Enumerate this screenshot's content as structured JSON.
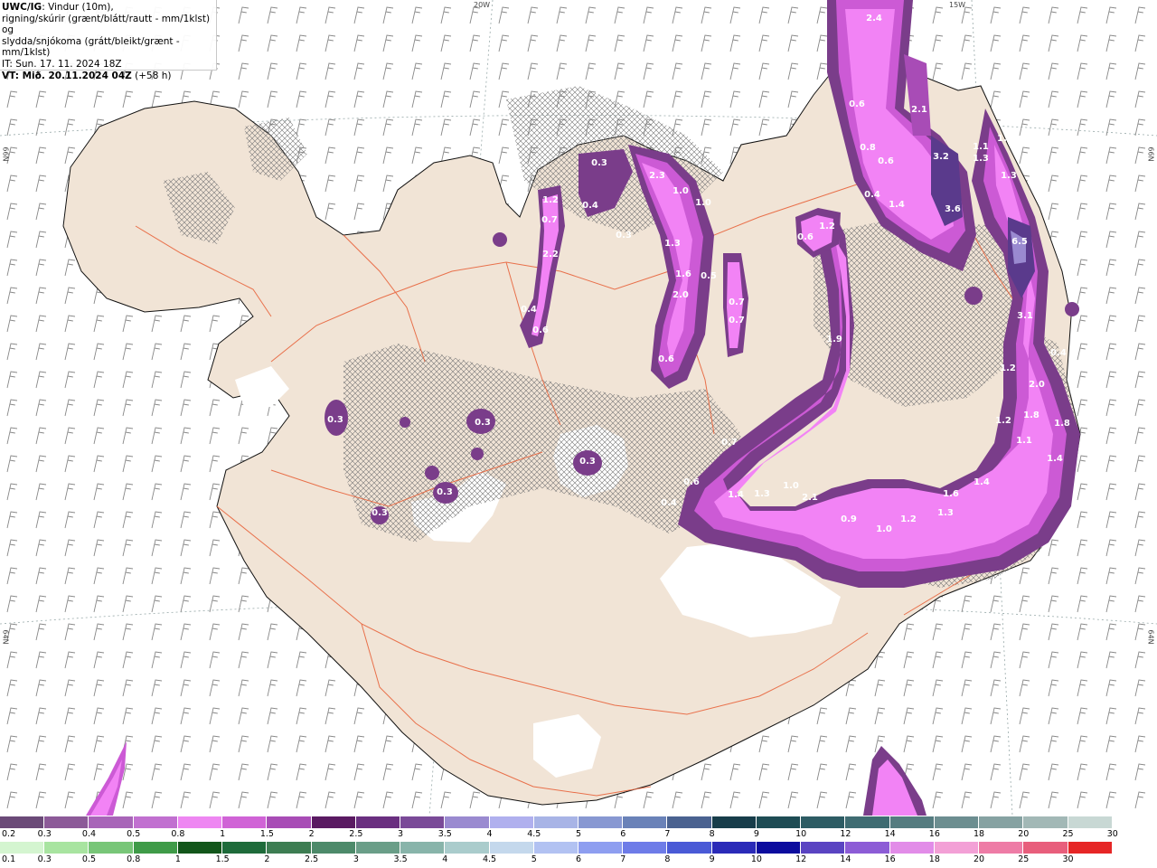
{
  "header": {
    "model": "UWC/IG",
    "title_rest": ": Vindur (10m),",
    "line2": "rigning/skúrir (grænt/blátt/rautt - mm/1klst) og",
    "line3": "slydda/snjókoma (grátt/bleikt/grænt - mm/1klst)",
    "issue_time": "IT: Sun. 17. 11. 2024 18Z",
    "valid_time": "VT: Mið. 20.11.2024 04Z",
    "forecast_offset": " (+58 h)"
  },
  "grid_labels": {
    "lon_20w": "20W",
    "lon_15w": "15W",
    "lat_66n_left": "66N",
    "lat_66n_right": "66N",
    "lat_64n_left": "64N",
    "lat_64n_right": "64N"
  },
  "colors": {
    "land": "#f1e4d6",
    "sea": "#ffffff",
    "roads": "#e8643c",
    "snow_light": "#f283f5",
    "snow_mid": "#cc5ad5",
    "snow_dark": "#7a3d8a",
    "snow_core": "#5a3a8c"
  },
  "precip_values": [
    {
      "v": "2.4"
    },
    {
      "v": "0.6"
    },
    {
      "v": "2.1"
    },
    {
      "v": "0.8"
    },
    {
      "v": "0.6"
    },
    {
      "v": "3.2"
    },
    {
      "v": "1.1"
    },
    {
      "v": "1.3"
    },
    {
      "v": "0.4"
    },
    {
      "v": "1.4"
    },
    {
      "v": "3.6"
    },
    {
      "v": "1.3"
    },
    {
      "v": "1.3"
    },
    {
      "v": "0.3"
    },
    {
      "v": "2.3"
    },
    {
      "v": "1.0"
    },
    {
      "v": "1.0"
    },
    {
      "v": "1.2"
    },
    {
      "v": "0.7"
    },
    {
      "v": "0.4"
    },
    {
      "v": "0.6"
    },
    {
      "v": "1.2"
    },
    {
      "v": "0.3"
    },
    {
      "v": "6.5"
    },
    {
      "v": "1.3"
    },
    {
      "v": "2.2"
    },
    {
      "v": "1.6"
    },
    {
      "v": "0.5"
    },
    {
      "v": "2.0"
    },
    {
      "v": "0.7"
    },
    {
      "v": "0.4"
    },
    {
      "v": "0.7"
    },
    {
      "v": "0.6"
    },
    {
      "v": "1.9"
    },
    {
      "v": "3.1"
    },
    {
      "v": "0.6"
    },
    {
      "v": "0.4"
    },
    {
      "v": "0.3"
    },
    {
      "v": "0.3"
    },
    {
      "v": "1.2"
    },
    {
      "v": "2.0"
    },
    {
      "v": "1.8"
    },
    {
      "v": "1.2"
    },
    {
      "v": "1.8"
    },
    {
      "v": "0.7"
    },
    {
      "v": "1.1"
    },
    {
      "v": "0.3"
    },
    {
      "v": "0.3"
    },
    {
      "v": "1.4"
    },
    {
      "v": "0.6"
    },
    {
      "v": "1.4"
    },
    {
      "v": "1.3"
    },
    {
      "v": "1.0"
    },
    {
      "v": "2.1"
    },
    {
      "v": "1.4"
    },
    {
      "v": "0.4"
    },
    {
      "v": "0.3"
    },
    {
      "v": "0.9"
    },
    {
      "v": "1.0"
    },
    {
      "v": "1.2"
    },
    {
      "v": "1.3"
    },
    {
      "v": "1.6"
    }
  ],
  "legend_snow": {
    "labels": [
      "0.2",
      "0.3",
      "0.4",
      "0.5",
      "0.8",
      "1",
      "1.5",
      "2",
      "2.5",
      "3",
      "3.5",
      "4",
      "4.5",
      "5",
      "6",
      "7",
      "8",
      "9",
      "10",
      "12",
      "14",
      "16",
      "18",
      "20",
      "25",
      "30"
    ],
    "colors": [
      "#6b4a78",
      "#8c5a98",
      "#a865b8",
      "#c170d0",
      "#ee87f2",
      "#d063d6",
      "#a84cb6",
      "#5a1a62",
      "#6a2f80",
      "#7a4a98",
      "#9a8ad0",
      "#b0b0ee",
      "#a8b4e6",
      "#8898d2",
      "#6a82b8",
      "#4a6290",
      "#173d4a",
      "#1e4c54",
      "#2d5c64",
      "#3f6c72",
      "#557c80",
      "#6c8e90",
      "#86a2a2",
      "#a2b8b6",
      "#c8d8d4",
      "#ffffff"
    ]
  },
  "legend_rain": {
    "labels": [
      "0.1",
      "0.3",
      "0.5",
      "0.8",
      "1",
      "1.5",
      "2",
      "2.5",
      "3",
      "3.5",
      "4",
      "4.5",
      "5",
      "6",
      "7",
      "8",
      "9",
      "10",
      "12",
      "14",
      "16",
      "18",
      "20",
      "25",
      "30"
    ],
    "colors": [
      "#d4f5d0",
      "#a8e4a0",
      "#78c678",
      "#3f9b48",
      "#12561a",
      "#1e6b3a",
      "#3d7d52",
      "#4d8a6a",
      "#6a9e88",
      "#88b4aa",
      "#aacccc",
      "#c4d8ec",
      "#b2c2f2",
      "#8e9ef0",
      "#6e7ce8",
      "#4a5ad6",
      "#2a2ab8",
      "#0c0c9e",
      "#5a44c2",
      "#8c5cd6",
      "#e28ce8",
      "#f3a0d6",
      "#ee7ca6",
      "#e85e7c",
      "#e62626"
    ]
  }
}
